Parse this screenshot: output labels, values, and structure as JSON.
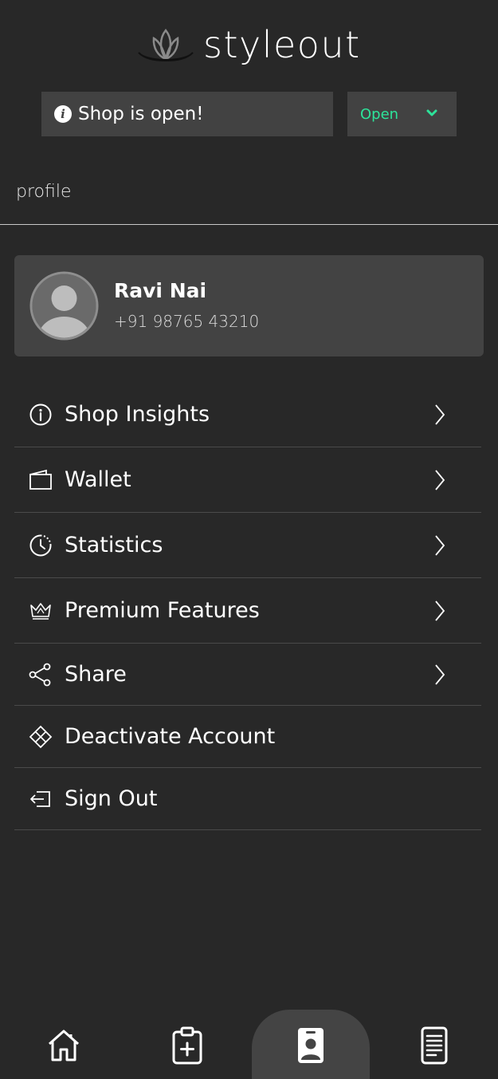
{
  "app": {
    "brand": "styleout"
  },
  "shop_status": {
    "message": "Shop is open!",
    "selected": "Open",
    "accent_color": "#2de39a"
  },
  "section": {
    "title": "profile"
  },
  "profile": {
    "name": "Ravi Nai",
    "phone": "+91 98765 43210"
  },
  "menu": {
    "items": [
      {
        "label": "Shop Insights",
        "icon": "info-icon",
        "has_arrow": true
      },
      {
        "label": "Wallet",
        "icon": "wallet-icon",
        "has_arrow": true
      },
      {
        "label": "Statistics",
        "icon": "clock-icon",
        "has_arrow": true
      },
      {
        "label": "Premium Features",
        "icon": "crown-icon",
        "has_arrow": true
      },
      {
        "label": "Share",
        "icon": "share-icon",
        "has_arrow": true
      },
      {
        "label": "Deactivate Account",
        "icon": "diamond-icon",
        "has_arrow": false
      },
      {
        "label": "Sign Out",
        "icon": "sign-out-icon",
        "has_arrow": false
      }
    ]
  },
  "bottom_nav": {
    "items": [
      {
        "icon": "home-icon",
        "active": false
      },
      {
        "icon": "clipboard-add-icon",
        "active": false
      },
      {
        "icon": "profile-badge-icon",
        "active": true
      },
      {
        "icon": "document-icon",
        "active": false
      }
    ]
  }
}
